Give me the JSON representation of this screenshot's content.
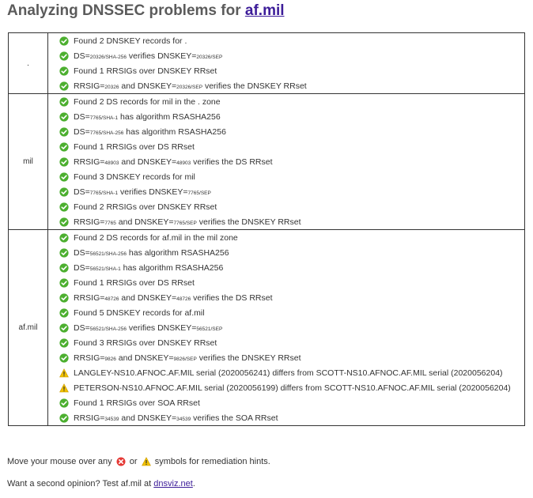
{
  "header": {
    "title_prefix": "Analyzing DNSSEC problems for",
    "domain_link": "af.mil"
  },
  "colors": {
    "ok": "#4caf2f",
    "warn": "#f2c200",
    "error": "#e53935",
    "link": "#3d1d99"
  },
  "zones": [
    {
      "name": ".",
      "checks": [
        {
          "status": "ok",
          "parts": [
            {
              "t": "Found 2 DNSKEY records for ."
            }
          ]
        },
        {
          "status": "ok",
          "parts": [
            {
              "t": "DS="
            },
            {
              "t": "20326/SHA-256",
              "s": 1
            },
            {
              "t": " verifies DNSKEY="
            },
            {
              "t": "20326/SEP",
              "s": 1
            }
          ]
        },
        {
          "status": "ok",
          "parts": [
            {
              "t": "Found 1 RRSIGs over DNSKEY RRset"
            }
          ]
        },
        {
          "status": "ok",
          "parts": [
            {
              "t": "RRSIG="
            },
            {
              "t": "20326",
              "s": 1
            },
            {
              "t": " and DNSKEY="
            },
            {
              "t": "20326/SEP",
              "s": 1
            },
            {
              "t": " verifies the DNSKEY RRset"
            }
          ]
        }
      ]
    },
    {
      "name": "mil",
      "checks": [
        {
          "status": "ok",
          "parts": [
            {
              "t": "Found 2 DS records for mil in the . zone"
            }
          ]
        },
        {
          "status": "ok",
          "parts": [
            {
              "t": "DS="
            },
            {
              "t": "7765/SHA-1",
              "s": 1
            },
            {
              "t": " has algorithm RSASHA256"
            }
          ]
        },
        {
          "status": "ok",
          "parts": [
            {
              "t": "DS="
            },
            {
              "t": "7765/SHA-256",
              "s": 1
            },
            {
              "t": " has algorithm RSASHA256"
            }
          ]
        },
        {
          "status": "ok",
          "parts": [
            {
              "t": "Found 1 RRSIGs over DS RRset"
            }
          ]
        },
        {
          "status": "ok",
          "parts": [
            {
              "t": "RRSIG="
            },
            {
              "t": "48903",
              "s": 1
            },
            {
              "t": " and DNSKEY="
            },
            {
              "t": "48903",
              "s": 1
            },
            {
              "t": " verifies the DS RRset"
            }
          ]
        },
        {
          "status": "ok",
          "parts": [
            {
              "t": "Found 3 DNSKEY records for mil"
            }
          ]
        },
        {
          "status": "ok",
          "parts": [
            {
              "t": "DS="
            },
            {
              "t": "7765/SHA-1",
              "s": 1
            },
            {
              "t": " verifies DNSKEY="
            },
            {
              "t": "7765/SEP",
              "s": 1
            }
          ]
        },
        {
          "status": "ok",
          "parts": [
            {
              "t": "Found 2 RRSIGs over DNSKEY RRset"
            }
          ]
        },
        {
          "status": "ok",
          "parts": [
            {
              "t": "RRSIG="
            },
            {
              "t": "7765",
              "s": 1
            },
            {
              "t": " and DNSKEY="
            },
            {
              "t": "7765/SEP",
              "s": 1
            },
            {
              "t": " verifies the DNSKEY RRset"
            }
          ]
        }
      ]
    },
    {
      "name": "af.mil",
      "checks": [
        {
          "status": "ok",
          "parts": [
            {
              "t": "Found 2 DS records for af.mil in the mil zone"
            }
          ]
        },
        {
          "status": "ok",
          "parts": [
            {
              "t": "DS="
            },
            {
              "t": "56521/SHA-256",
              "s": 1
            },
            {
              "t": " has algorithm RSASHA256"
            }
          ]
        },
        {
          "status": "ok",
          "parts": [
            {
              "t": "DS="
            },
            {
              "t": "56521/SHA-1",
              "s": 1
            },
            {
              "t": " has algorithm RSASHA256"
            }
          ]
        },
        {
          "status": "ok",
          "parts": [
            {
              "t": "Found 1 RRSIGs over DS RRset"
            }
          ]
        },
        {
          "status": "ok",
          "parts": [
            {
              "t": "RRSIG="
            },
            {
              "t": "48726",
              "s": 1
            },
            {
              "t": " and DNSKEY="
            },
            {
              "t": "48726",
              "s": 1
            },
            {
              "t": " verifies the DS RRset"
            }
          ]
        },
        {
          "status": "ok",
          "parts": [
            {
              "t": "Found 5 DNSKEY records for af.mil"
            }
          ]
        },
        {
          "status": "ok",
          "parts": [
            {
              "t": "DS="
            },
            {
              "t": "56521/SHA-256",
              "s": 1
            },
            {
              "t": " verifies DNSKEY="
            },
            {
              "t": "56521/SEP",
              "s": 1
            }
          ]
        },
        {
          "status": "ok",
          "parts": [
            {
              "t": "Found 3 RRSIGs over DNSKEY RRset"
            }
          ]
        },
        {
          "status": "ok",
          "parts": [
            {
              "t": "RRSIG="
            },
            {
              "t": "9826",
              "s": 1
            },
            {
              "t": " and DNSKEY="
            },
            {
              "t": "9826/SEP",
              "s": 1
            },
            {
              "t": " verifies the DNSKEY RRset"
            }
          ]
        },
        {
          "status": "warn",
          "parts": [
            {
              "t": "LANGLEY-NS10.AFNOC.AF.MIL serial (2020056241) differs from SCOTT-NS10.AFNOC.AF.MIL serial (2020056204)"
            }
          ]
        },
        {
          "status": "warn",
          "parts": [
            {
              "t": "PETERSON-NS10.AFNOC.AF.MIL serial (2020056199) differs from SCOTT-NS10.AFNOC.AF.MIL serial (2020056204)"
            }
          ]
        },
        {
          "status": "ok",
          "parts": [
            {
              "t": "Found 1 RRSIGs over SOA RRset"
            }
          ]
        },
        {
          "status": "ok",
          "parts": [
            {
              "t": "RRSIG="
            },
            {
              "t": "34539",
              "s": 1
            },
            {
              "t": " and DNSKEY="
            },
            {
              "t": "34539",
              "s": 1
            },
            {
              "t": " verifies the SOA RRset"
            }
          ]
        }
      ]
    }
  ],
  "footer": {
    "hint_prefix": "Move your mouse over any",
    "hint_or": "or",
    "hint_suffix": "symbols for remediation hints.",
    "opinion_prefix": "Want a second opinion? Test af.mil at",
    "opinion_link": "dnsviz.net",
    "opinion_suffix": "."
  }
}
